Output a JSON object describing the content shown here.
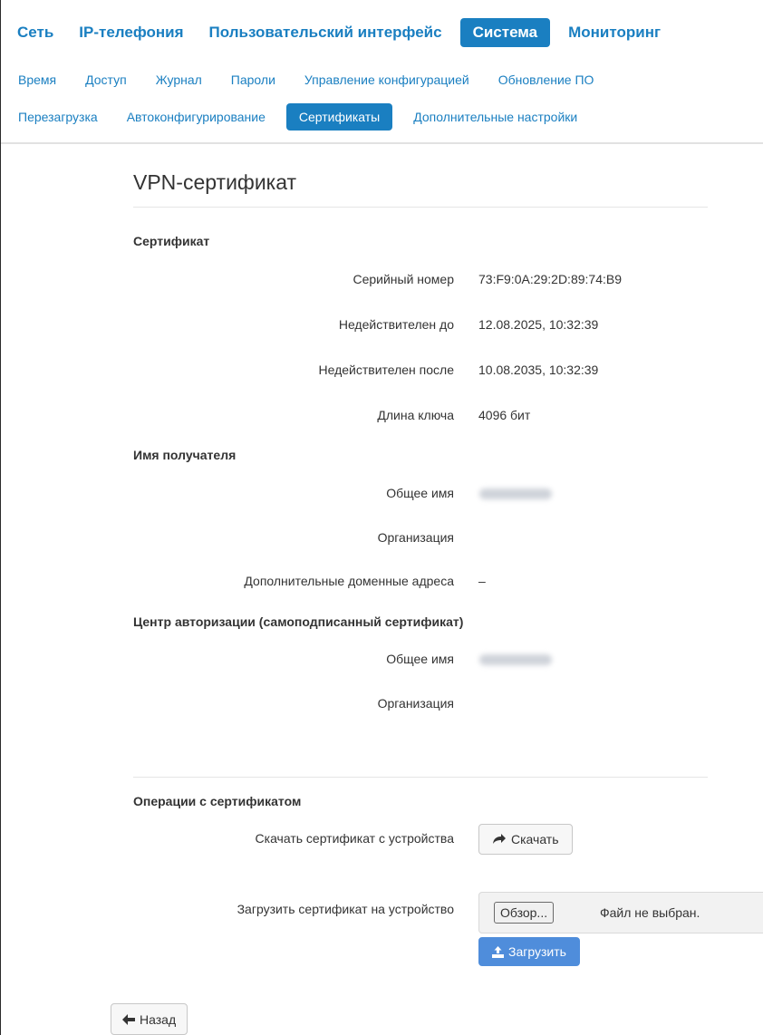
{
  "nav": {
    "top": [
      "Сеть",
      "IP-телефония",
      "Пользовательский интерфейс",
      "Система",
      "Мониторинг"
    ],
    "sub_row1": [
      "Время",
      "Доступ",
      "Журнал",
      "Пароли",
      "Управление конфигурацией",
      "Обновление ПО"
    ],
    "sub_row2": [
      "Перезагрузка",
      "Автоконфигурирование",
      "Сертификаты",
      "Дополнительные настройки"
    ]
  },
  "page": {
    "title": "VPN-сертификат",
    "certificate": {
      "heading": "Сертификат",
      "serial_label": "Серийный номер",
      "serial_value": "73:F9:0A:29:2D:89:74:B9",
      "not_before_label": "Недействителен до",
      "not_before_value": "12.08.2025, 10:32:39",
      "not_after_label": "Недействителен после",
      "not_after_value": "10.08.2035, 10:32:39",
      "key_length_label": "Длина ключа",
      "key_length_value": "4096 бит"
    },
    "subject": {
      "heading": "Имя получателя",
      "common_name_label": "Общее имя",
      "organization_label": "Организация",
      "alt_names_label": "Дополнительные доменные адреса",
      "alt_names_value": "–"
    },
    "issuer": {
      "heading": "Центр авторизации (самоподписанный сертификат)",
      "common_name_label": "Общее имя",
      "organization_label": "Организация"
    },
    "operations": {
      "heading": "Операции с сертификатом",
      "download_label": "Скачать сертификат с устройства",
      "download_button": "Скачать",
      "upload_label": "Загрузить сертификат на устройство",
      "browse_button": "Обзор...",
      "file_status": "Файл не выбран.",
      "upload_button": "Загрузить"
    },
    "back_button": "Назад"
  },
  "colors": {
    "accent": "#1a7fc1",
    "primary_button": "#4f8ddb"
  },
  "icons": {
    "download": "share-arrow-icon",
    "upload": "upload-icon",
    "back": "arrow-left-icon"
  }
}
